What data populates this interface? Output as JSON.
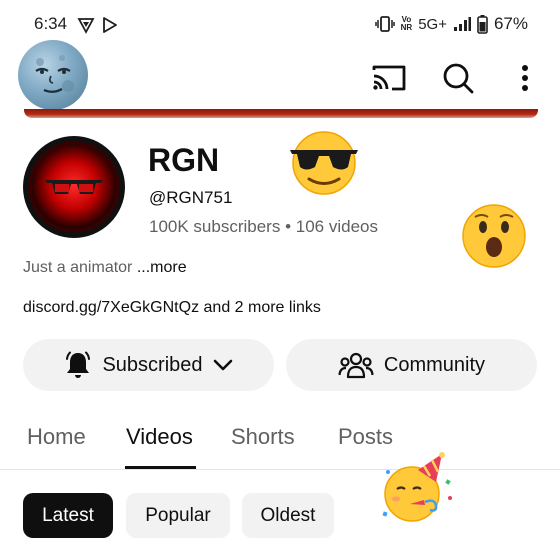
{
  "status_bar": {
    "time": "6:34",
    "network_vo": "Vo",
    "network_nr": "NR",
    "network_type": "5G+",
    "battery_percent": "67%"
  },
  "top_bar": {
    "icons": [
      "cast-icon",
      "search-icon",
      "more-vert-icon"
    ]
  },
  "channel": {
    "name": "RGN",
    "handle": "@RGN751",
    "subscribers": "100K subscribers",
    "separator": "•",
    "videos": "106 videos",
    "description": "Just a animator ",
    "description_more": "...more",
    "links": "discord.gg/7XeGkGNtQz and 2 more links"
  },
  "actions": {
    "subscribed_label": "Subscribed",
    "community_label": "Community"
  },
  "tabs": [
    {
      "label": "Home",
      "active": false
    },
    {
      "label": "Videos",
      "active": true
    },
    {
      "label": "Shorts",
      "active": false
    },
    {
      "label": "Posts",
      "active": false
    }
  ],
  "chips": [
    {
      "label": "Latest",
      "active": true
    },
    {
      "label": "Popular",
      "active": false
    },
    {
      "label": "Oldest",
      "active": false
    }
  ],
  "colors": {
    "accent_banner": "#b52a14",
    "chip_active_bg": "#0f0f0f",
    "pill_bg": "#f2f2f2",
    "secondary_text": "#606060"
  }
}
